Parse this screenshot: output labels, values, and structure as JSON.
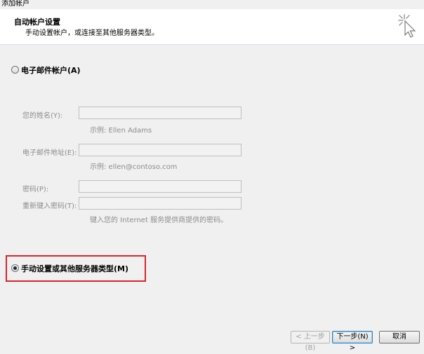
{
  "window": {
    "title": "添加帐户"
  },
  "header": {
    "title": "自动帐户设置",
    "subtitle": "手动设置帐户，或连接至其他服务器类型。",
    "icon": "wizard-cursor-icon"
  },
  "email_account": {
    "radio_label": "电子邮件帐户(A)",
    "name_label": "您的姓名(Y):",
    "name_value": "",
    "name_hint": "示例: Ellen Adams",
    "email_label": "电子邮件地址(E):",
    "email_value": "",
    "email_hint": "示例: ellen@contoso.com",
    "password_label": "密码(P):",
    "password_value": "",
    "retype_label": "重新键入密码(T):",
    "retype_value": "",
    "password_hint": "键入您的 Internet 服务提供商提供的密码。"
  },
  "manual": {
    "radio_label": "手动设置或其他服务器类型(M)",
    "selected": true
  },
  "buttons": {
    "back": "< 上一步(B)",
    "next": "下一步(N) >",
    "cancel": "取消"
  },
  "colors": {
    "highlight": "#d9262b"
  }
}
